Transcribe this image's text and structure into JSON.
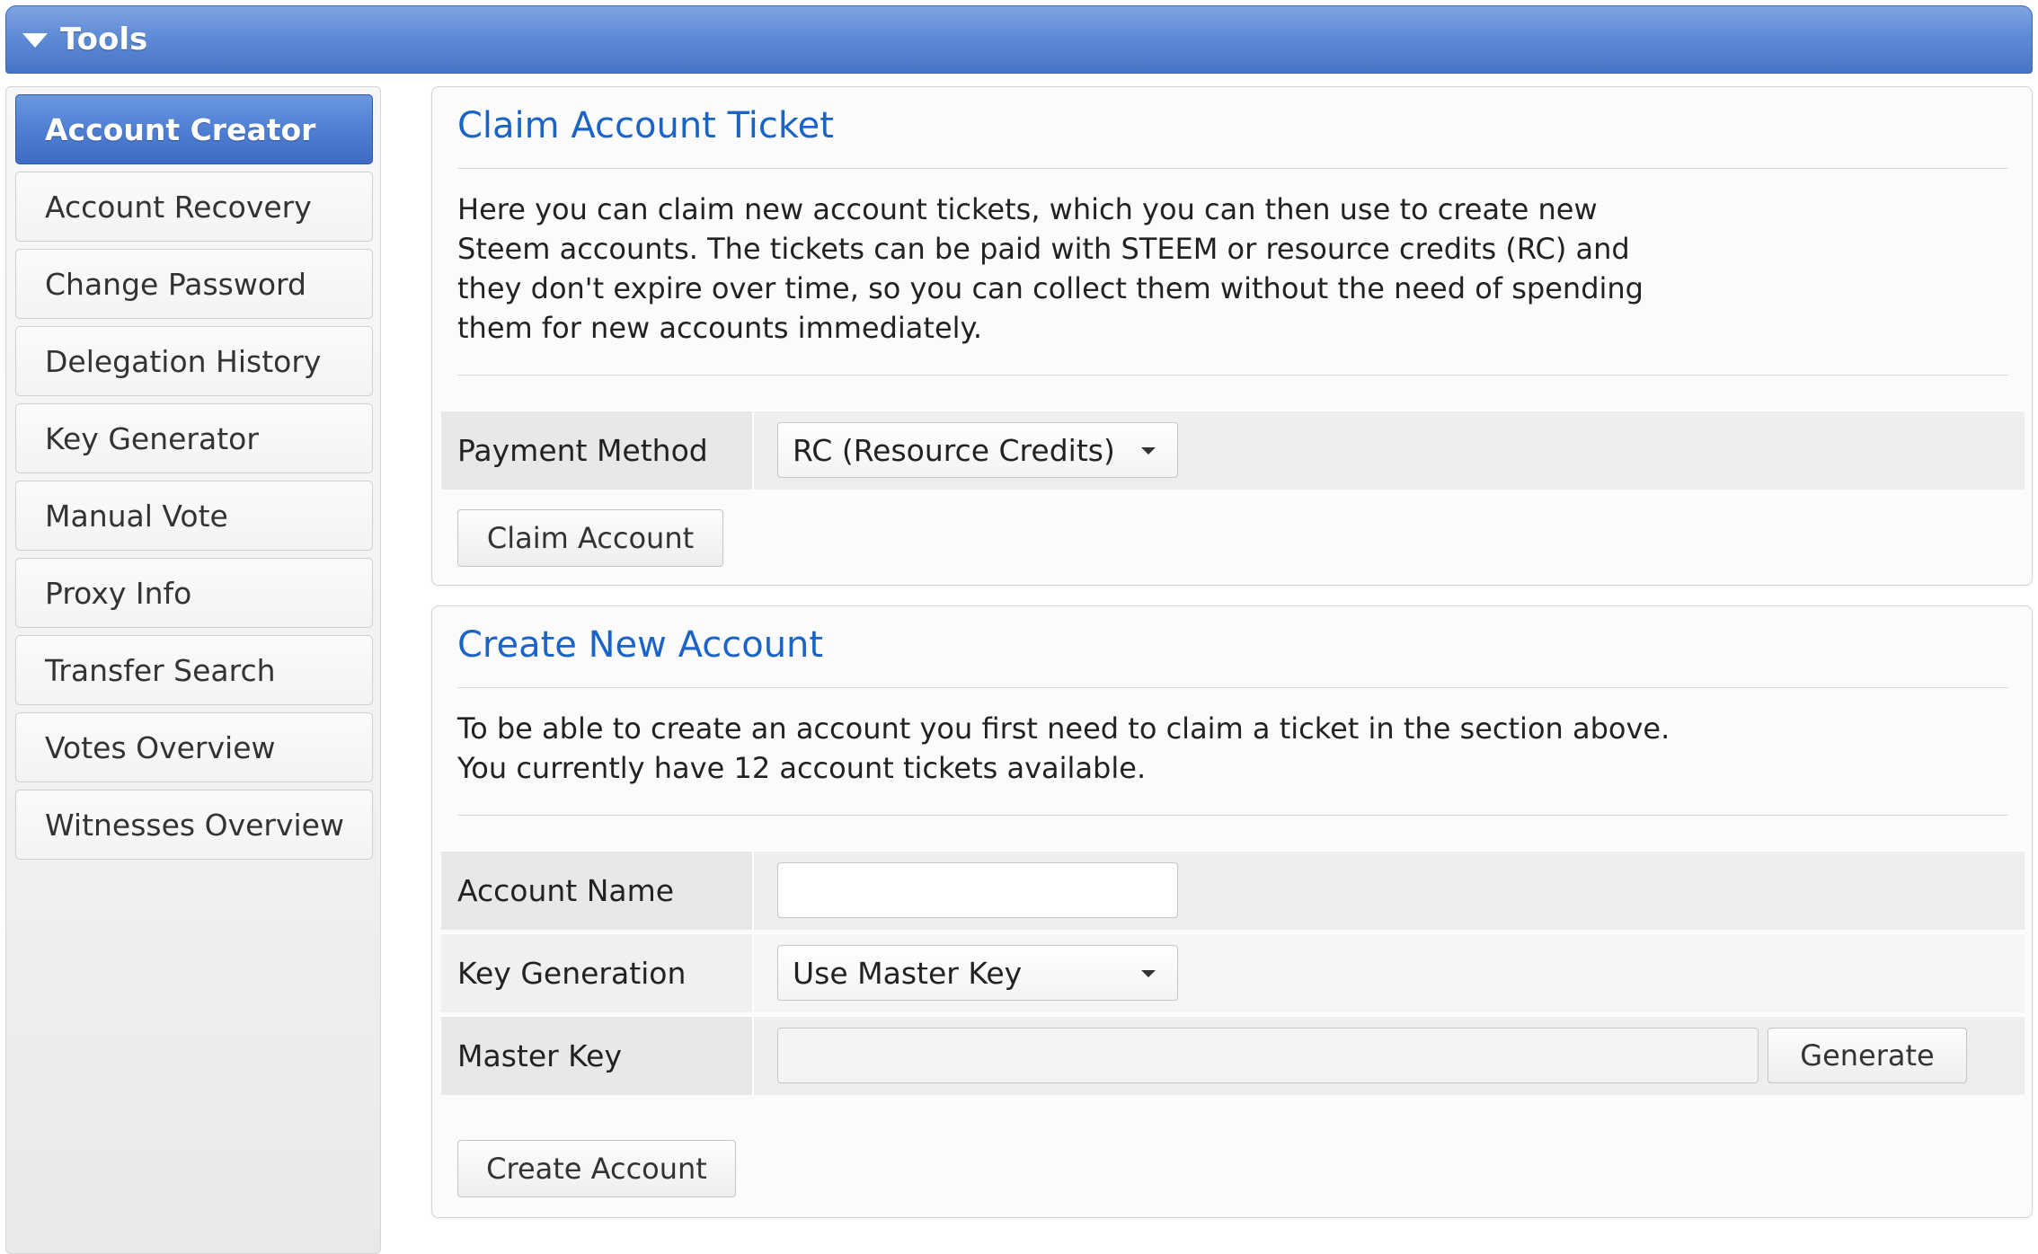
{
  "header": {
    "title": "Tools",
    "icon": "triangle-down-icon"
  },
  "sidebar": {
    "items": [
      {
        "label": "Account Creator",
        "active": true
      },
      {
        "label": "Account Recovery",
        "active": false
      },
      {
        "label": "Change Password",
        "active": false
      },
      {
        "label": "Delegation History",
        "active": false
      },
      {
        "label": "Key Generator",
        "active": false
      },
      {
        "label": "Manual Vote",
        "active": false
      },
      {
        "label": "Proxy Info",
        "active": false
      },
      {
        "label": "Transfer Search",
        "active": false
      },
      {
        "label": "Votes Overview",
        "active": false
      },
      {
        "label": "Witnesses Overview",
        "active": false
      }
    ]
  },
  "claim_panel": {
    "title": "Claim Account Ticket",
    "description": "Here you can claim new account tickets, which you can then use to create new Steem accounts. The tickets can be paid with STEEM or resource credits (RC) and they don't expire over time, so you can collect them without the need of spending them for new accounts immediately.",
    "payment_method_label": "Payment Method",
    "payment_method_value": "RC (Resource Credits)",
    "claim_button": "Claim Account"
  },
  "create_panel": {
    "title": "Create New Account",
    "description_line1": "To be able to create an account you first need to claim a ticket in the section above.",
    "description_line2": "You currently have 12 account tickets available.",
    "account_name_label": "Account Name",
    "account_name_value": "",
    "key_generation_label": "Key Generation",
    "key_generation_value": "Use Master Key",
    "master_key_label": "Master Key",
    "master_key_value": "",
    "generate_button": "Generate",
    "create_button": "Create Account"
  },
  "colors": {
    "accent_blue": "#4f7fd3",
    "title_blue": "#1a64c8"
  }
}
